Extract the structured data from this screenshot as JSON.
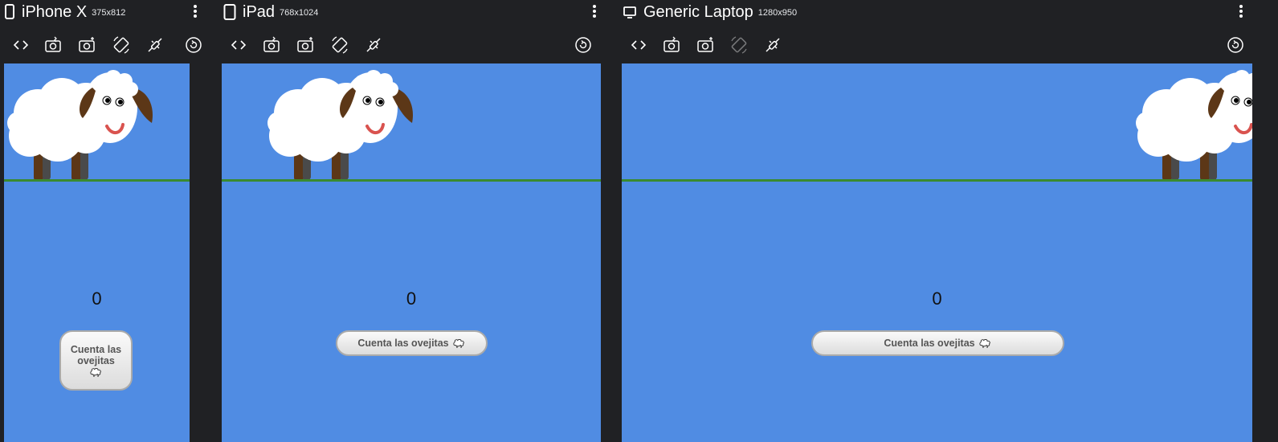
{
  "devices": [
    {
      "name": "iPhone X",
      "size": "375x812",
      "counter": "0",
      "button_label": "Cuenta las ovejitas"
    },
    {
      "name": "iPad",
      "size": "768x1024",
      "counter": "0",
      "button_label": "Cuenta las ovejitas"
    },
    {
      "name": "Generic Laptop",
      "size": "1280x950",
      "counter": "0",
      "button_label": "Cuenta las ovejitas"
    }
  ],
  "toolbar_icons": [
    "toggle-code-icon",
    "screenshot-icon",
    "add-screenshot-icon",
    "rotate-device-icon",
    "disconnect-icon",
    "refresh-icon"
  ],
  "colors": {
    "background": "#202124",
    "viewport": "#508ce3",
    "grass": "#3a8a2f",
    "sheep_body": "#ffffff",
    "sheep_ear": "#5c3717",
    "mouth": "#d9534f"
  }
}
